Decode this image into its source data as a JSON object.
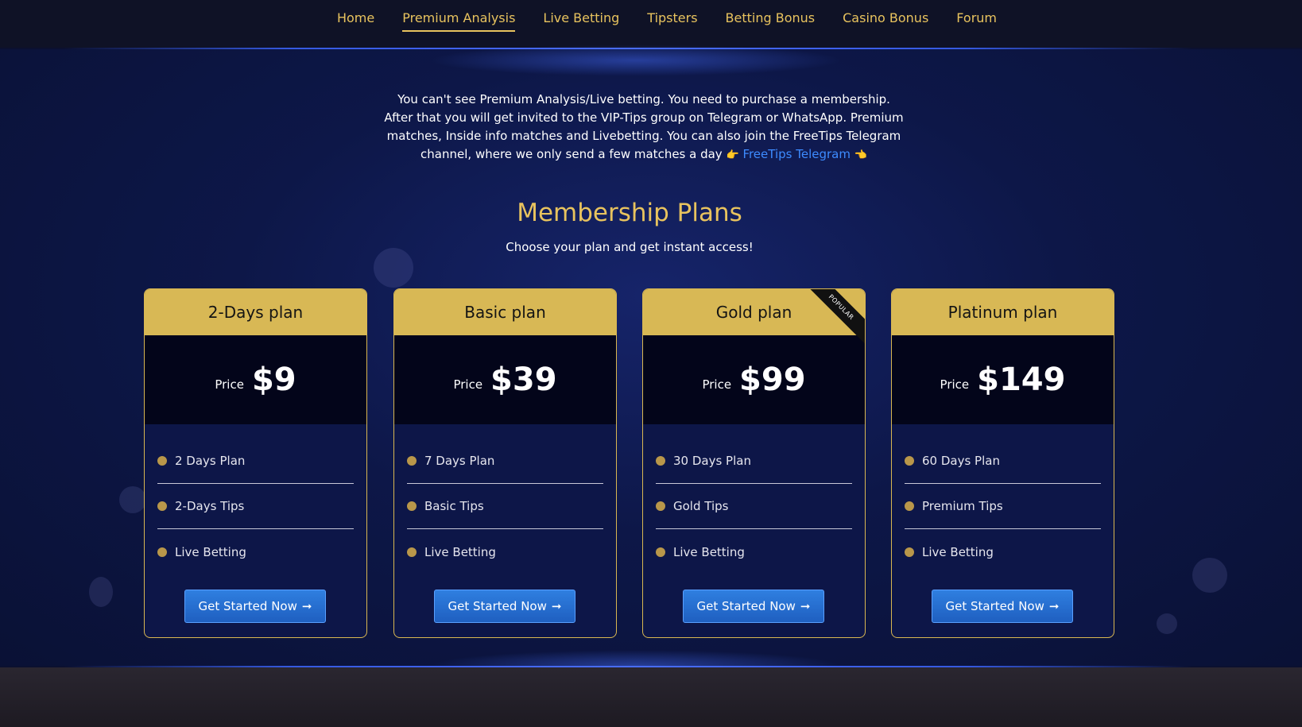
{
  "nav": {
    "items": [
      {
        "label": "Home",
        "active": false
      },
      {
        "label": "Premium Analysis",
        "active": true
      },
      {
        "label": "Live Betting",
        "active": false
      },
      {
        "label": "Tipsters",
        "active": false
      },
      {
        "label": "Betting Bonus",
        "active": false
      },
      {
        "label": "Casino Bonus",
        "active": false
      },
      {
        "label": "Forum",
        "active": false
      }
    ]
  },
  "intro": {
    "text": "You can't see Premium Analysis/Live betting. You need to purchase a membership. After that you will get invited to the VIP-Tips group on Telegram or WhatsApp. Premium matches, Inside info matches and Livebetting. You can also join the FreeTips Telegram channel, where we only send a few matches a day",
    "hand_left": "👉",
    "link": "FreeTips Telegram",
    "hand_right": "👈"
  },
  "plans": {
    "title": "Membership Plans",
    "subtitle": "Choose your plan and get instant access!",
    "price_label": "Price",
    "button_label": "Get Started Now",
    "button_arrow": "➞",
    "items": [
      {
        "name": "2-Days plan",
        "price": "$9",
        "ribbon": "",
        "features": [
          "2 Days Plan",
          "2-Days Tips",
          "Live Betting"
        ]
      },
      {
        "name": "Basic plan",
        "price": "$39",
        "ribbon": "",
        "features": [
          "7 Days Plan",
          "Basic Tips",
          "Live Betting"
        ]
      },
      {
        "name": "Gold plan",
        "price": "$99",
        "ribbon": "POPULAR",
        "features": [
          "30 Days Plan",
          "Gold Tips",
          "Live Betting"
        ]
      },
      {
        "name": "Platinum plan",
        "price": "$149",
        "ribbon": "",
        "features": [
          "60 Days Plan",
          "Premium Tips",
          "Live Betting"
        ]
      }
    ]
  },
  "colors": {
    "accent_gold": "#e8c35e",
    "header_gold": "#d8b855",
    "button_blue": "#2f7fe0",
    "link_blue": "#3d8bff",
    "background": "#0b1030"
  }
}
